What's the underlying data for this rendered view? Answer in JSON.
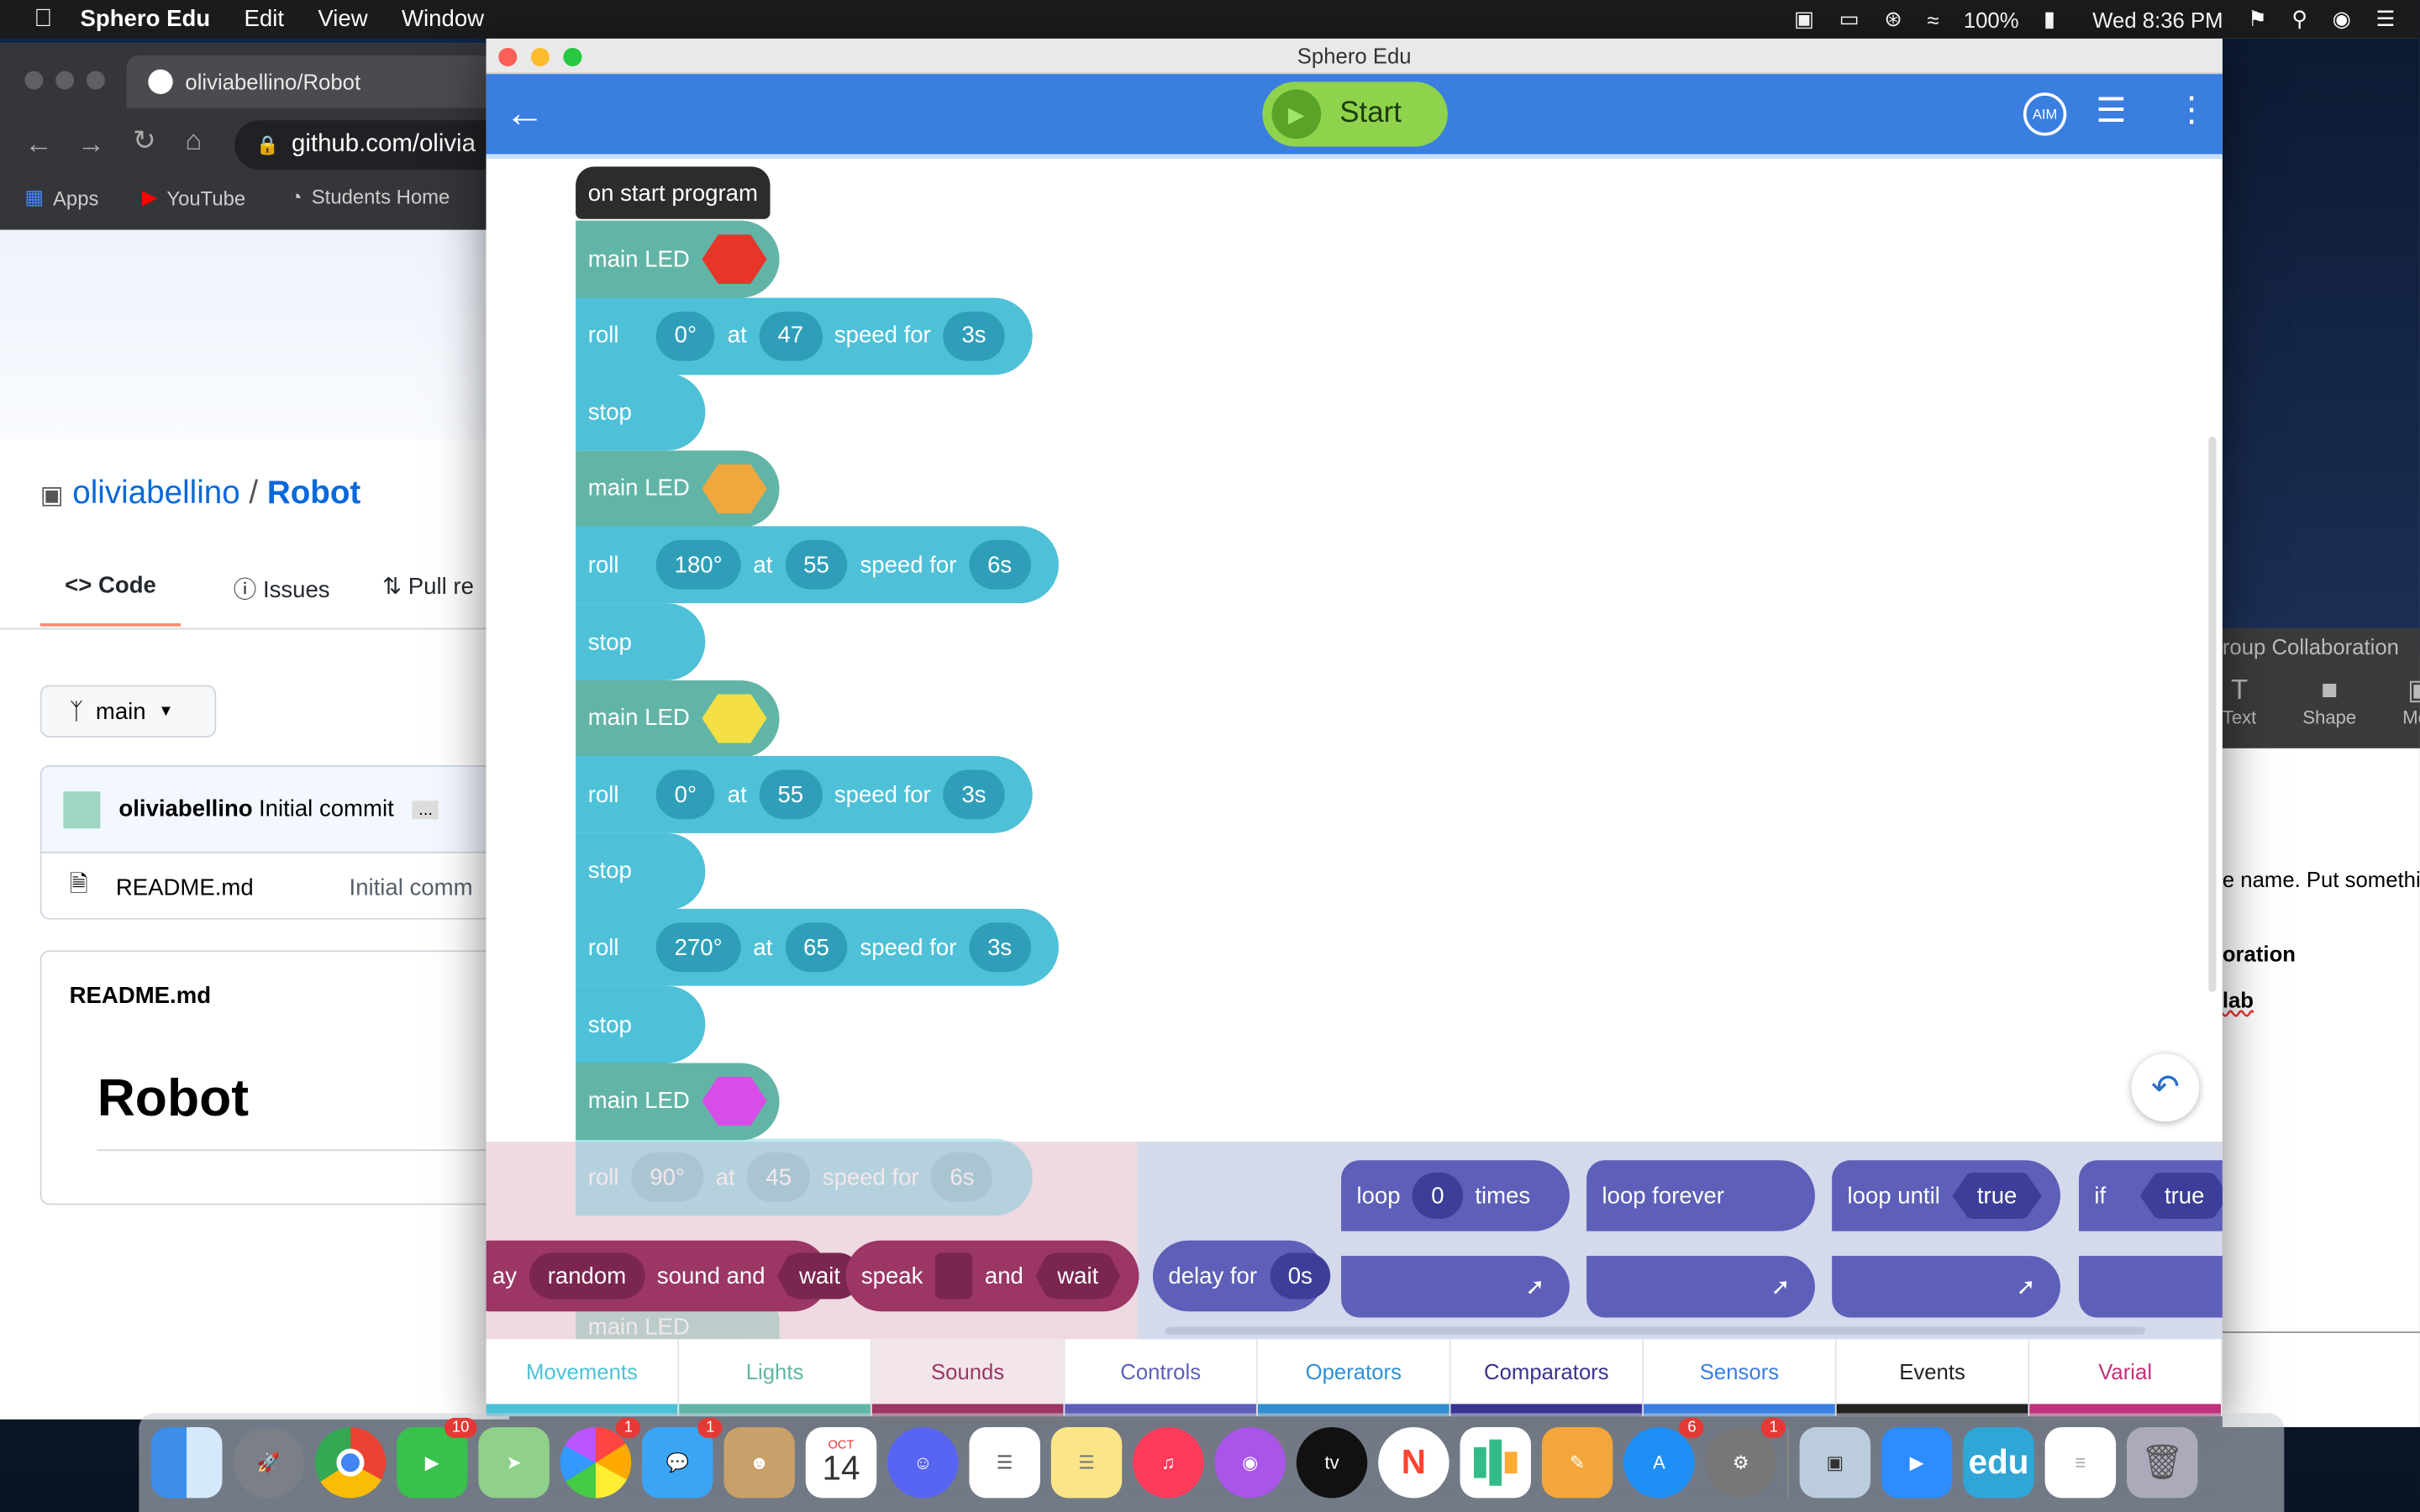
{
  "menubar": {
    "app": "Sphero Edu",
    "items": [
      "Edit",
      "View",
      "Window"
    ],
    "battery": "100%",
    "clock": "Wed 8:36 PM"
  },
  "chrome": {
    "tab_title": "oliviabellino/Robot",
    "address": "github.com/olivia",
    "bookmarks": [
      "Apps",
      "YouTube",
      "Students Home"
    ]
  },
  "github": {
    "owner": "oliviabellino",
    "sep": "/",
    "repo": "Robot",
    "tabs": [
      "Code",
      "Issues",
      "Pull re"
    ],
    "branch": "main",
    "commit_author": "oliviabellino",
    "commit_msg": "Initial commit",
    "more": "...",
    "file": "README.md",
    "file_commit": "Initial comm",
    "readme_title": "README.md",
    "readme_heading": "Robot"
  },
  "window": {
    "title": "Sphero Edu",
    "start_label": "Start",
    "aim_label": "AIM"
  },
  "program": {
    "header": "on start program",
    "blocks": [
      {
        "type": "led",
        "label": "main LED",
        "color": "#e8352a"
      },
      {
        "type": "roll",
        "label": "roll",
        "heading": "0°",
        "at": "at",
        "speed": "47",
        "speed_for": "speed for",
        "dur": "3s"
      },
      {
        "type": "stop",
        "label": "stop"
      },
      {
        "type": "led",
        "label": "main LED",
        "color": "#f0a73c"
      },
      {
        "type": "roll",
        "label": "roll",
        "heading": "180°",
        "at": "at",
        "speed": "55",
        "speed_for": "speed for",
        "dur": "6s"
      },
      {
        "type": "stop",
        "label": "stop"
      },
      {
        "type": "led",
        "label": "main LED",
        "color": "#f4e044"
      },
      {
        "type": "roll",
        "label": "roll",
        "heading": "0°",
        "at": "at",
        "speed": "55",
        "speed_for": "speed for",
        "dur": "3s"
      },
      {
        "type": "stop",
        "label": "stop"
      },
      {
        "type": "roll",
        "label": "roll",
        "heading": "270°",
        "at": "at",
        "speed": "65",
        "speed_for": "speed for",
        "dur": "3s"
      },
      {
        "type": "stop",
        "label": "stop"
      },
      {
        "type": "led",
        "label": "main LED",
        "color": "#d84de8"
      },
      {
        "type": "roll",
        "label": "roll",
        "heading": "90°",
        "at": "at",
        "speed": "45",
        "speed_for": "speed for",
        "dur": "6s"
      }
    ],
    "faded_led": "main LED"
  },
  "tray": {
    "sound_prefix": "ay",
    "sound_value": "random",
    "sound_mid": "sound and",
    "sound_wait": "wait",
    "speak": "speak",
    "speak_and": "and",
    "speak_wait": "wait",
    "delay": "delay for",
    "delay_value": "0s",
    "loop_label": "loop",
    "loop_count": "0",
    "loop_times": "times",
    "loop_forever": "loop forever",
    "loop_until": "loop until",
    "loop_until_value": "true",
    "if_label": "if",
    "if_value": "true"
  },
  "categories": [
    {
      "label": "Movements",
      "color": "#4ec1d8"
    },
    {
      "label": "Lights",
      "color": "#62b5a6"
    },
    {
      "label": "Sounds",
      "color": "#9b3665"
    },
    {
      "label": "Controls",
      "color": "#5d5fb8"
    },
    {
      "label": "Operators",
      "color": "#2f8fd0"
    },
    {
      "label": "Comparators",
      "color": "#3a3390"
    },
    {
      "label": "Sensors",
      "color": "#3a7ee0"
    },
    {
      "label": "Events",
      "color": "#222222"
    },
    {
      "label": "Varial",
      "color": "#c0327a"
    }
  ],
  "right_panel": {
    "heading": "roup Collaboration",
    "tools": [
      "Text",
      "Shape",
      "Med"
    ],
    "text1": "e name. Put somethi",
    "text2": "oration",
    "text3": "lab"
  },
  "dock": {
    "calendar_month": "OCT",
    "calendar_day": "14",
    "badges": {
      "facetime": "10",
      "photos": "1",
      "messages": "1",
      "appstore": "6",
      "prefs": "1"
    },
    "edu_label": "edu"
  }
}
